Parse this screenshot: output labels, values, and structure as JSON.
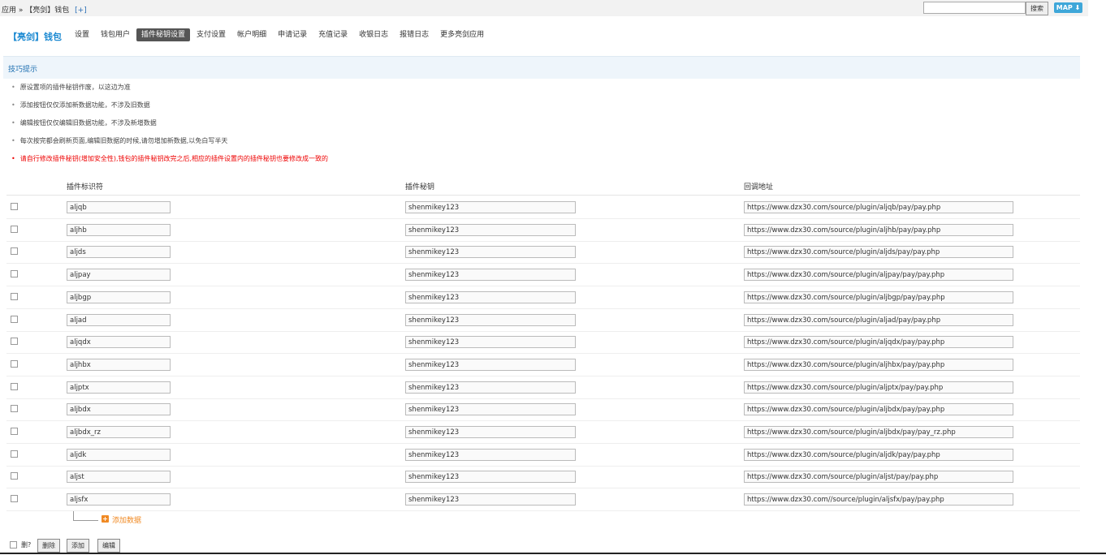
{
  "breadcrumb": {
    "app": "应用 »",
    "current": "【亮剑】钱包",
    "add": "[+]"
  },
  "search": {
    "value": "",
    "button": "搜索",
    "map_button": "MAP"
  },
  "brand": "【亮剑】钱包",
  "nav": [
    "设置",
    "钱包用户",
    "插件秘钥设置",
    "支付设置",
    "帐户明细",
    "申请记录",
    "充值记录",
    "收银日志",
    "报错日志",
    "更多亮剑应用"
  ],
  "active_nav": "插件秘钥设置",
  "tips_title": "技巧提示",
  "tips": [
    "原设置项的插件秘钥作废，以这边为准",
    "添加按钮仅仅添加新数据功能，不涉及旧数据",
    "编辑按钮仅仅编辑旧数据功能，不涉及新增数据",
    "每次按完都会刷新页面,编辑旧数据的时候,请勿增加新数据,以免白写半天",
    "请自行修改插件秘钥(增加安全性),钱包的插件秘钥改完之后,相应的插件设置内的插件秘钥也要修改成一致的"
  ],
  "table": {
    "headers": [
      "插件标识符",
      "插件秘钥",
      "回调地址"
    ],
    "rows": [
      [
        "aljqb",
        "shenmikey123",
        "https://www.dzx30.com/source/plugin/aljqb/pay/pay.php"
      ],
      [
        "aljhb",
        "shenmikey123",
        "https://www.dzx30.com/source/plugin/aljhb/pay/pay.php"
      ],
      [
        "aljds",
        "shenmikey123",
        "https://www.dzx30.com/source/plugin/aljds/pay/pay.php"
      ],
      [
        "aljpay",
        "shenmikey123",
        "https://www.dzx30.com/source/plugin/aljpay/pay/pay.php"
      ],
      [
        "aljbgp",
        "shenmikey123",
        "https://www.dzx30.com/source/plugin/aljbgp/pay/pay.php"
      ],
      [
        "aljad",
        "shenmikey123",
        "https://www.dzx30.com/source/plugin/aljad/pay/pay.php"
      ],
      [
        "aljqdx",
        "shenmikey123",
        "https://www.dzx30.com/source/plugin/aljqdx/pay/pay.php"
      ],
      [
        "aljhbx",
        "shenmikey123",
        "https://www.dzx30.com/source/plugin/aljhbx/pay/pay.php"
      ],
      [
        "aljptx",
        "shenmikey123",
        "https://www.dzx30.com/source/plugin/aljptx/pay/pay.php"
      ],
      [
        "aljbdx",
        "shenmikey123",
        "https://www.dzx30.com/source/plugin/aljbdx/pay/pay.php"
      ],
      [
        "aljbdx_rz",
        "shenmikey123",
        "https://www.dzx30.com/source/plugin/aljbdx/pay/pay_rz.php"
      ],
      [
        "aljdk",
        "shenmikey123",
        "https://www.dzx30.com/source/plugin/aljdk/pay/pay.php"
      ],
      [
        "aljst",
        "shenmikey123",
        "https://www.dzx30.com/source/plugin/aljst/pay/pay.php"
      ],
      [
        "aljsfx",
        "shenmikey123",
        "https://www.dzx30.com//source/plugin/aljsfx/pay/pay.php"
      ]
    ]
  },
  "add_data": "添加数据",
  "footer": {
    "delete_label": "删?",
    "delete_btn": "删除",
    "add_btn": "添加",
    "edit_btn": "编辑"
  }
}
